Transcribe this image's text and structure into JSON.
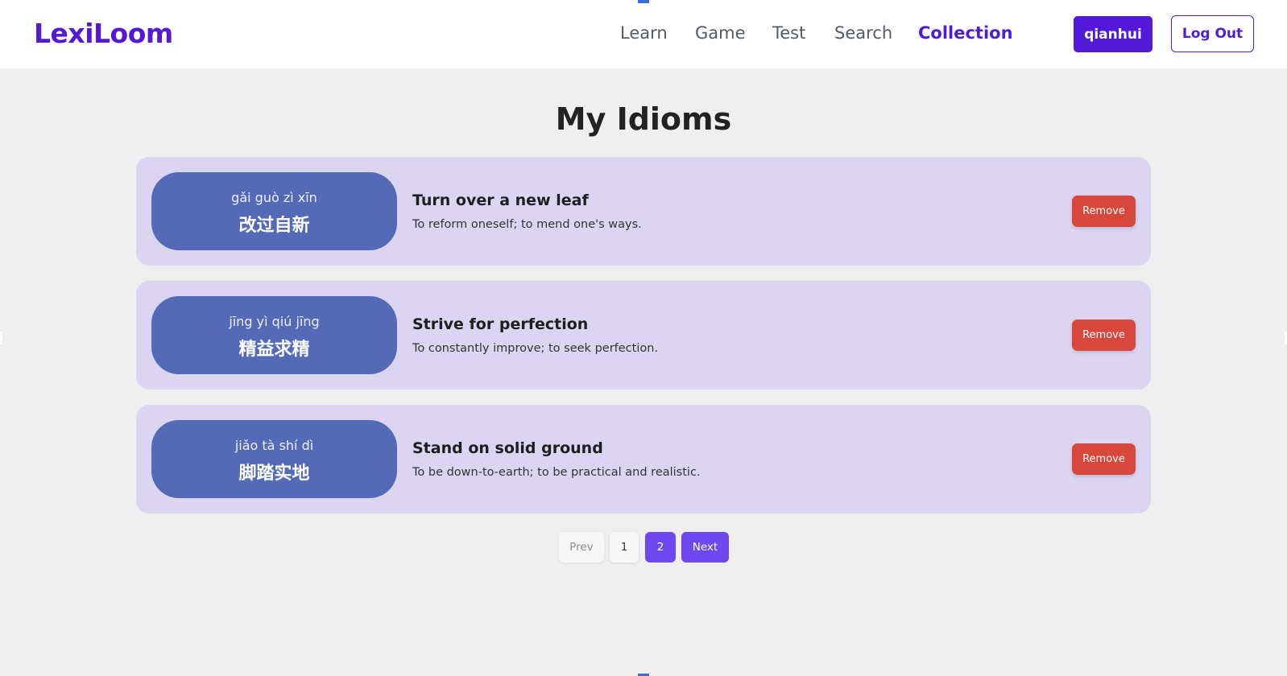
{
  "brand": "LexiLoom",
  "nav": {
    "links": [
      "Learn",
      "Game",
      "Test",
      "Search",
      "Collection"
    ],
    "active": "Collection"
  },
  "user": {
    "name": "qianhui",
    "logout_label": "Log Out"
  },
  "page_title": "My Idioms",
  "idioms": [
    {
      "pinyin": "gǎi guò zì xīn",
      "hanzi": "改过自新",
      "title": "Turn over a new leaf",
      "description": "To reform oneself; to mend one's ways.",
      "remove_label": "Remove"
    },
    {
      "pinyin": "jīng yì qiú jīng",
      "hanzi": "精益求精",
      "title": "Strive for perfection",
      "description": "To constantly improve; to seek perfection.",
      "remove_label": "Remove"
    },
    {
      "pinyin": "jiǎo tà shí dì",
      "hanzi": "脚踏实地",
      "title": "Stand on solid ground",
      "description": "To be down-to-earth; to be practical and realistic.",
      "remove_label": "Remove"
    }
  ],
  "pagination": {
    "prev_label": "Prev",
    "pages": [
      "1",
      "2"
    ],
    "current_page": "2",
    "next_label": "Next"
  },
  "colors": {
    "brand": "#5319d9",
    "card_bg": "#dbd5f2",
    "pill_bg": "#546ab6",
    "remove": "#d8473c",
    "page_active": "#6f47ee"
  }
}
